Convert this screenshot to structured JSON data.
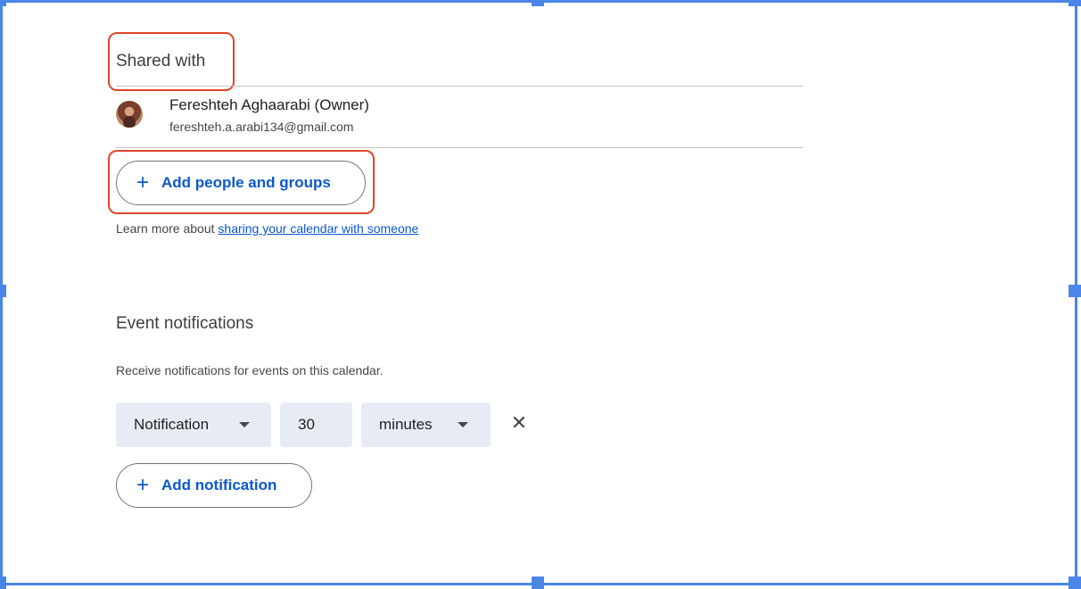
{
  "shared_with": {
    "title": "Shared with",
    "person": {
      "name": "Fereshteh Aghaarabi (Owner)",
      "email": "fereshteh.a.arabi134@gmail.com"
    },
    "add_button_label": "Add people and groups",
    "learn_more_prefix": "Learn more about ",
    "learn_more_link": "sharing your calendar with someone"
  },
  "event_notifications": {
    "title": "Event notifications",
    "description": "Receive notifications for events on this calendar.",
    "notification_type": "Notification",
    "amount": "30",
    "unit": "minutes",
    "add_button_label": "Add notification"
  },
  "icons": {
    "plus": "+",
    "close": "✕"
  },
  "colors": {
    "accent": "#0b57d0",
    "highlight": "#e0442b",
    "selection": "#4a86e8"
  }
}
